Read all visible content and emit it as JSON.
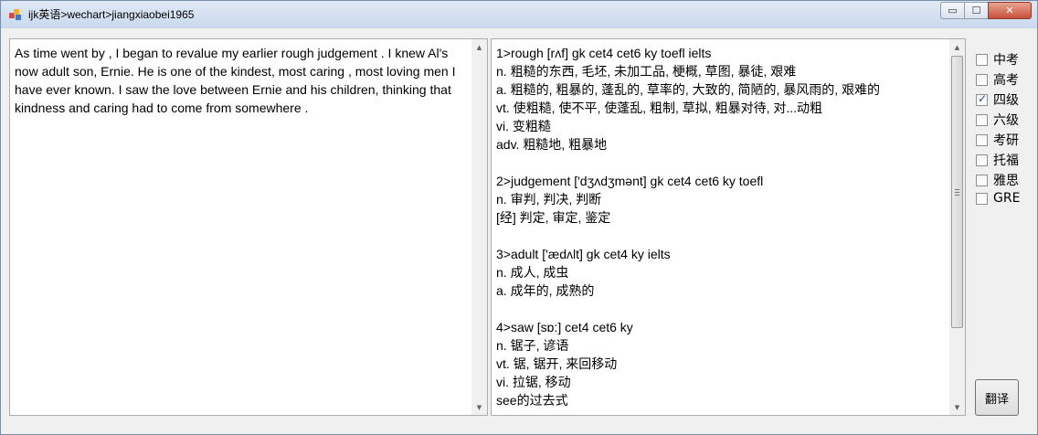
{
  "window": {
    "title": "ijk英语>wechart>jiangxiaobei1965",
    "caption_buttons": {
      "minimize": "▭",
      "maximize": "☐",
      "close": "✕"
    }
  },
  "source": {
    "text": "As time went by , I began to revalue my earlier rough judgement . I knew Al's now adult son, Ernie. He is one of the kindest, most caring , most loving men I have ever known. I saw the love between Ernie and his children, thinking that kindness and caring had to come from somewhere ."
  },
  "result": {
    "lines": [
      "1>rough [rʌf] gk cet4 cet6 ky toefl ielts",
      "n. 粗糙的东西, 毛坯, 未加工品, 梗概, 草图, 暴徒, 艰难",
      "a. 粗糙的, 粗暴的, 蓬乱的, 草率的, 大致的, 简陋的, 暴风雨的, 艰难的",
      "vt. 使粗糙, 使不平, 使蓬乱, 粗制, 草拟, 粗暴对待, 对...动粗",
      "vi. 变粗糙",
      "adv. 粗糙地, 粗暴地",
      "",
      "2>judgement ['dʒʌdʒmənt] gk cet4 cet6 ky toefl",
      "n. 审判, 判决, 判断",
      "[经] 判定, 审定, 鉴定",
      "",
      "3>adult ['ædʌlt] gk cet4 ky ielts",
      "n. 成人, 成虫",
      "a. 成年的, 成熟的",
      "",
      "4>saw [sɒ:] cet4 cet6 ky",
      "n. 锯子, 谚语",
      "vt. 锯, 锯开, 来回移动",
      "vi. 拉锯, 移动",
      "see的过去式"
    ]
  },
  "levels": [
    {
      "label": "中考",
      "checked": false
    },
    {
      "label": "高考",
      "checked": false
    },
    {
      "label": "四级",
      "checked": true
    },
    {
      "label": "六级",
      "checked": false
    },
    {
      "label": "考研",
      "checked": false
    },
    {
      "label": "托福",
      "checked": false
    },
    {
      "label": "雅思",
      "checked": false
    },
    {
      "label": "GRE",
      "checked": false
    }
  ],
  "translate_button": {
    "label": "翻译"
  },
  "scrollbar": {
    "up": "▲",
    "down": "▼"
  }
}
